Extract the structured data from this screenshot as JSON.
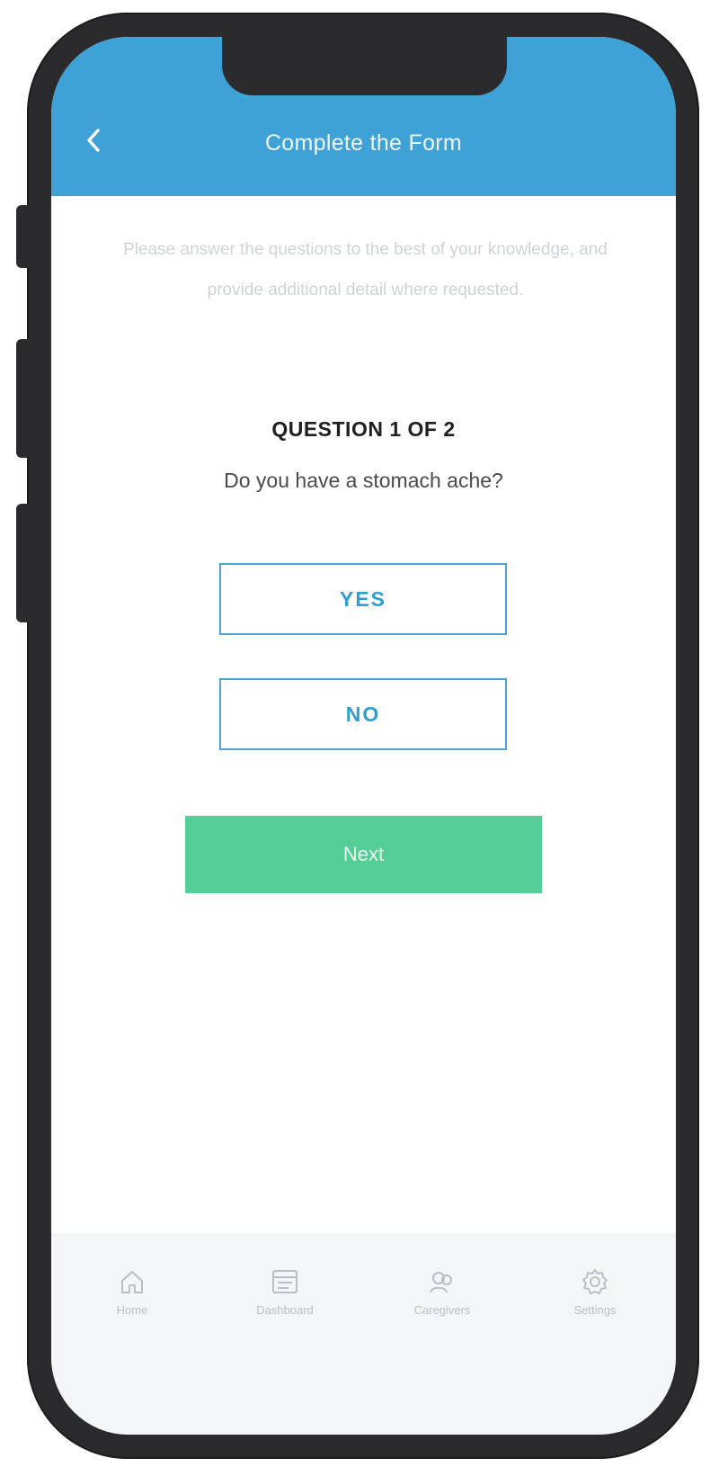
{
  "header": {
    "title": "Complete the Form",
    "back_icon": "chevron-left-icon"
  },
  "intro": {
    "text": "Please answer the questions to the best of your knowledge, and provide additional detail where requested."
  },
  "question": {
    "counter": "QUESTION 1 OF 2",
    "text": "Do you have a stomach ache?"
  },
  "answers": {
    "yes_label": "YES",
    "no_label": "NO"
  },
  "actions": {
    "next_label": "Next"
  },
  "tabbar": {
    "items": [
      {
        "label": "Home",
        "icon": "home-icon"
      },
      {
        "label": "Dashboard",
        "icon": "dashboard-icon"
      },
      {
        "label": "Caregivers",
        "icon": "caregivers-icon"
      },
      {
        "label": "Settings",
        "icon": "gear-icon"
      }
    ]
  },
  "colors": {
    "header": "#3ea2d6",
    "answer_border": "#4fa6cc",
    "answer_text": "#2e9fd0",
    "next_button": "#55ce97",
    "phone_frame": "#2b2b2d"
  }
}
